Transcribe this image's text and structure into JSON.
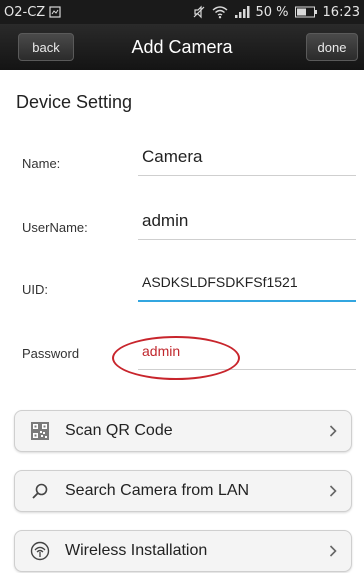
{
  "status_bar": {
    "carrier": "O2-CZ",
    "battery": "50 %",
    "time": "16:23"
  },
  "title_bar": {
    "back_label": "back",
    "title": "Add Camera",
    "done_label": "done"
  },
  "section": {
    "title": "Device Setting"
  },
  "form": {
    "name": {
      "label": "Name:",
      "value": "Camera"
    },
    "username": {
      "label": "UserName:",
      "value": "admin"
    },
    "uid": {
      "label": "UID:",
      "value": "ASDKSLDFSDKFSf1521"
    },
    "password": {
      "label": "Password",
      "value": "admin"
    }
  },
  "actions": [
    {
      "label": "Scan QR Code",
      "icon": "qr-code-icon"
    },
    {
      "label": "Search Camera from LAN",
      "icon": "search-icon"
    },
    {
      "label": "Wireless Installation",
      "icon": "wifi-icon"
    }
  ],
  "colors": {
    "focus_underline": "#33a6e0",
    "annotation_red": "#c8252c",
    "password_text": "#c0272d"
  }
}
